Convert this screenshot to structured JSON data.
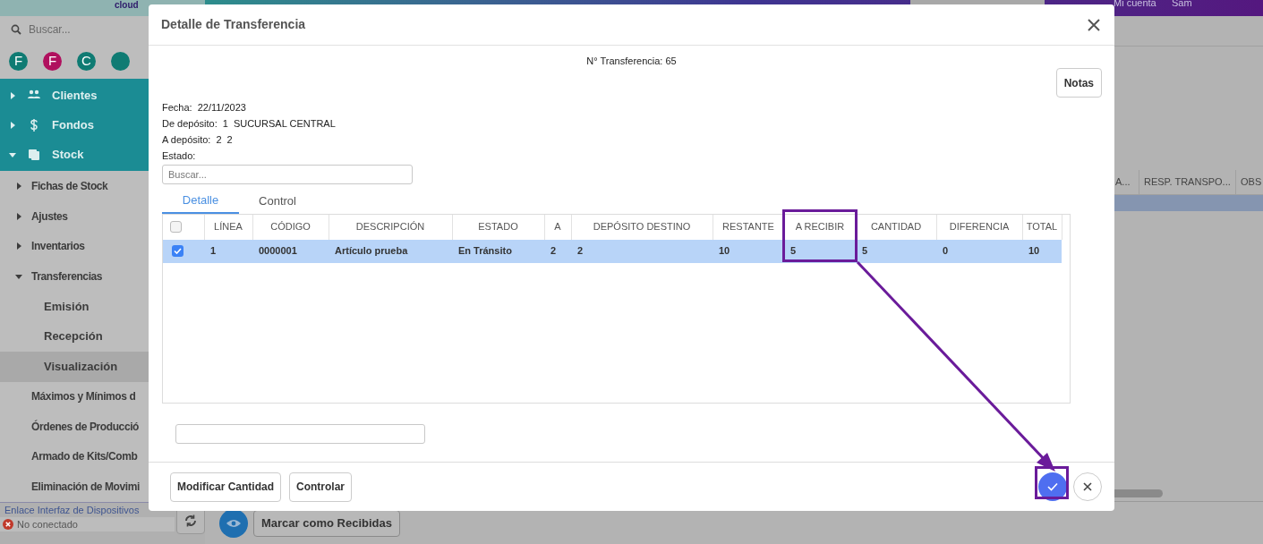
{
  "app": {
    "logo_text": "cloud",
    "account": "Mi cuenta",
    "user": "Sam"
  },
  "sidebar": {
    "search_placeholder": "Buscar...",
    "avatars": [
      {
        "letter": "F",
        "color": "#0f7b73"
      },
      {
        "letter": "F",
        "color": "#b0105e"
      },
      {
        "letter": "C",
        "color": "#0f7b73"
      },
      {
        "color": "#0f7b73"
      }
    ],
    "items": [
      {
        "label": "Clientes",
        "expanded": false,
        "selected": false
      },
      {
        "label": "Fondos",
        "expanded": false,
        "selected": false
      },
      {
        "label": "Stock",
        "expanded": true,
        "selected": false,
        "children": [
          {
            "label": "Fichas de Stock",
            "expanded": false,
            "selected": false
          },
          {
            "label": "Ajustes",
            "expanded": false,
            "selected": false
          },
          {
            "label": "Inventarios",
            "expanded": false,
            "selected": false
          },
          {
            "label": "Transferencias",
            "expanded": true,
            "selected": false,
            "children": [
              {
                "label": "Emisión",
                "selected": false
              },
              {
                "label": "Recepción",
                "selected": false
              },
              {
                "label": "Visualización",
                "selected": true
              }
            ]
          },
          {
            "label": "Máximos y Mínimos d",
            "selected": false
          },
          {
            "label": "Órdenes de Producció",
            "selected": false
          },
          {
            "label": "Armado de Kits/Comb",
            "selected": false
          },
          {
            "label": "Eliminación de Movimi",
            "selected": false
          }
        ]
      }
    ],
    "status": {
      "link": "Enlace Interfaz de Dispositivos",
      "state": "No conectado"
    }
  },
  "main": {
    "columns": [
      "A...",
      "RESP. TRANSPO...",
      "OBS"
    ],
    "action_button": "Marcar como Recibidas"
  },
  "dialog": {
    "title": "Detalle de Transferencia",
    "transfer_number": "N° Transferencia: 65",
    "notes_button": "Notas",
    "fields": [
      {
        "label": "Fecha:",
        "values": [
          "22/11/2023"
        ]
      },
      {
        "label": "De depósito:",
        "values": [
          "1",
          "SUCURSAL CENTRAL"
        ]
      },
      {
        "label": "A depósito:",
        "values": [
          "2",
          "2"
        ]
      },
      {
        "label": "Estado:"
      }
    ],
    "search_placeholder": "Buscar...",
    "tabs": [
      {
        "label": "Detalle",
        "selected": true
      },
      {
        "label": "Control",
        "selected": false
      }
    ],
    "table": {
      "header_checked": false,
      "columns": [
        "LÍNEA",
        "CÓDIGO",
        "DESCRIPCIÓN",
        "ESTADO",
        "A",
        "DEPÓSITO DESTINO",
        "RESTANTE",
        "A RECIBIR",
        "CANTIDAD",
        "DIFERENCIA",
        "TOTAL"
      ],
      "rows": [
        {
          "selected": true,
          "checked": true,
          "cells": [
            "1",
            "0000001",
            "Artículo prueba",
            "En Tránsito",
            "2",
            "2",
            "10",
            "5",
            "5",
            "0",
            "10"
          ]
        }
      ]
    },
    "footer_buttons": [
      "Modificar Cantidad",
      "Controlar"
    ]
  }
}
